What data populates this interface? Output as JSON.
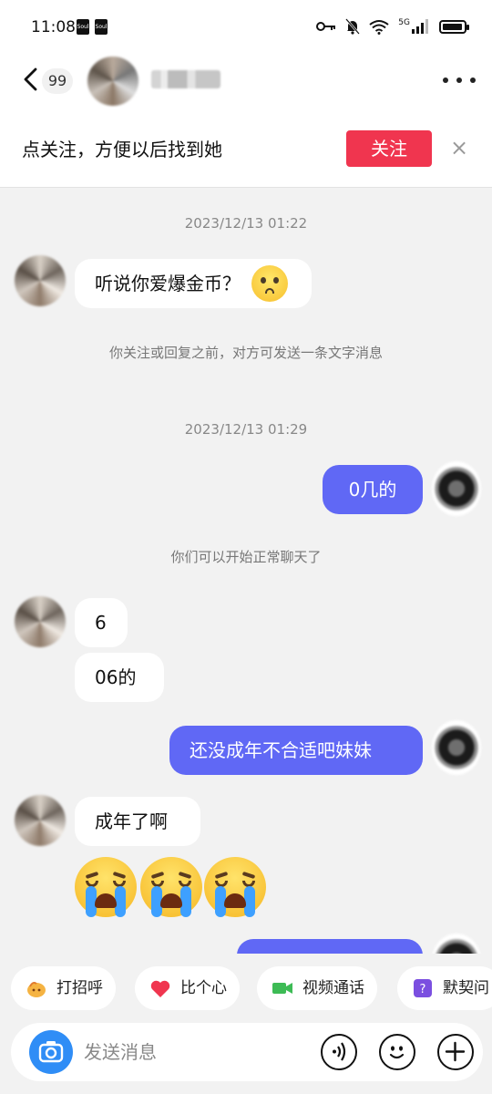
{
  "status_bar": {
    "time": "11:08",
    "app_badges": [
      "Soul",
      "Soul"
    ],
    "network": "5G",
    "icons": [
      "key-icon",
      "bell-muted-icon",
      "wifi-icon",
      "signal-icon",
      "battery-icon"
    ]
  },
  "header": {
    "unread_count": "99",
    "icons": [
      "back-icon",
      "more-icon"
    ]
  },
  "follow_bar": {
    "text": "点关注，方便以后找到她",
    "button": "关注",
    "close": "×"
  },
  "chat": {
    "timestamp_1": "2023/12/13 01:22",
    "msg_1": "听说你爱爆金币？",
    "msg_1_emoji": "pleading-face-emoji",
    "notice_1": "你关注或回复之前，对方可发送一条文字消息",
    "timestamp_2": "2023/12/13 01:29",
    "msg_2": "0几的",
    "notice_2": "你们可以开始正常聊天了",
    "msg_3": "6",
    "msg_4": "06的",
    "msg_5": "还没成年不合适吧妹妹",
    "msg_6": "成年了啊",
    "msg_7_emojis": [
      "loudly-crying-face-emoji",
      "loudly-crying-face-emoji",
      "loudly-crying-face-emoji"
    ]
  },
  "quick_actions": [
    {
      "label": "打招呼",
      "icon": "wave-hand-icon"
    },
    {
      "label": "比个心",
      "icon": "heart-icon"
    },
    {
      "label": "视频通话",
      "icon": "video-camera-icon"
    },
    {
      "label": "默契问",
      "icon": "question-card-icon"
    }
  ],
  "composer": {
    "placeholder": "发送消息",
    "icons": [
      "camera-icon",
      "voice-icon",
      "emoji-icon",
      "plus-icon"
    ]
  },
  "colors": {
    "accent_red": "#f0354f",
    "bubble_out": "#6068f5",
    "bubble_in": "#ffffff",
    "background": "#f2f2f2",
    "camera_blue": "#2f8df6"
  }
}
